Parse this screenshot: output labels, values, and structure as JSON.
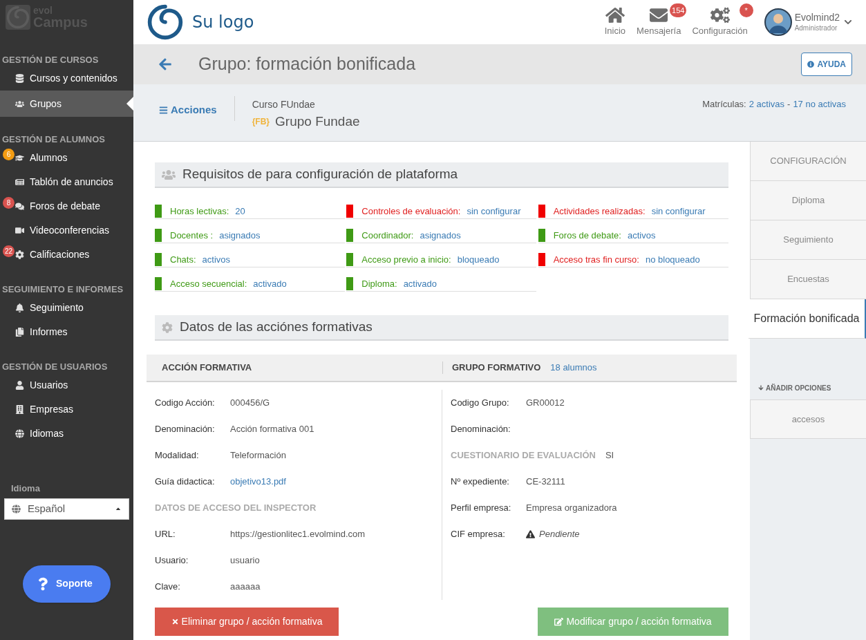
{
  "sidebar": {
    "brand": {
      "top": "evol",
      "bottom": "Campus"
    },
    "sections": [
      {
        "title": "GESTIÓN DE CURSOS",
        "items": [
          {
            "label": "Cursos y contenidos",
            "selected": false
          },
          {
            "label": "Grupos",
            "selected": true
          }
        ]
      },
      {
        "title": "GESTIÓN DE ALUMNOS",
        "items": [
          {
            "label": "Alumnos",
            "selected": false,
            "badge": "6",
            "color": "#f39c12"
          },
          {
            "label": "Tablón de anuncios",
            "selected": false
          },
          {
            "label": "Foros de debate",
            "selected": false,
            "badge": "8",
            "color": "#d9534f"
          },
          {
            "label": "Videoconferencias",
            "selected": false
          },
          {
            "label": "Calificaciones",
            "selected": false,
            "badge": "22",
            "color": "#d9534f"
          }
        ]
      },
      {
        "title": "SEGUIMIENTO E INFORMES",
        "items": [
          {
            "label": "Seguimiento",
            "selected": false
          },
          {
            "label": "Informes",
            "selected": false
          }
        ]
      },
      {
        "title": "GESTIÓN DE USUARIOS",
        "items": [
          {
            "label": "Usuarios",
            "selected": false
          },
          {
            "label": "Empresas",
            "selected": false
          },
          {
            "label": "Idiomas",
            "selected": false
          }
        ]
      }
    ],
    "language": {
      "label": "Idioma",
      "value": "Español"
    },
    "support": "Soporte"
  },
  "header": {
    "logo": "Su logo",
    "nav": [
      {
        "label": "Inicio"
      },
      {
        "label": "Mensajería",
        "badge": "154"
      },
      {
        "label": "Configuración",
        "badge": "*"
      }
    ],
    "user": {
      "name": "Evolmind2",
      "role": "Administrador"
    }
  },
  "title_bar": {
    "title": "Grupo: formación bonificada",
    "help": "AYUDA"
  },
  "sub_header": {
    "actions": "Acciones",
    "course": "Curso FUndae",
    "tag": "{FB}",
    "group": "Grupo Fundae",
    "enrollments_label": "Matrículas:",
    "active": "2 activas",
    "separator": "-",
    "inactive": "17 no activas"
  },
  "requirements": {
    "title": "Requisitos de para configuración de plataforma",
    "items": [
      {
        "label": "Horas lectivas:",
        "value": "20",
        "ok": true
      },
      {
        "label": "Controles de evaluación:",
        "value": "sin configurar",
        "ok": false
      },
      {
        "label": "Actividades realizadas:",
        "value": "sin configurar",
        "ok": false
      },
      {
        "label": "Docentes :",
        "value": "asignados",
        "ok": true
      },
      {
        "label": "Coordinador:",
        "value": "asignados",
        "ok": true
      },
      {
        "label": "Foros de debate:",
        "value": "activos",
        "ok": true
      },
      {
        "label": "Chats:",
        "value": "activos",
        "ok": true
      },
      {
        "label": "Acceso previo a inicio:",
        "value": "bloqueado",
        "ok": true
      },
      {
        "label": "Acceso tras fin curso:",
        "value": "no bloqueado",
        "ok": false
      },
      {
        "label": "Acceso secuencial:",
        "value": "activado",
        "ok": true
      },
      {
        "label": "Diploma:",
        "value": "activado",
        "ok": true
      }
    ]
  },
  "training": {
    "title": "Datos de las acciónes formativas",
    "left": {
      "heading": "ACCIÓN FORMATIVA",
      "rows": [
        {
          "kind": "field",
          "label": "Codigo Acción:",
          "value": "000456/G"
        },
        {
          "kind": "field",
          "label": "Denominación:",
          "value": "Acción formativa 001"
        },
        {
          "kind": "field",
          "label": "Modalidad:",
          "value": "Teleformación"
        },
        {
          "kind": "link",
          "label": "Guía didactica:",
          "value": "objetivo13.pdf"
        },
        {
          "kind": "heading",
          "label": "DATOS DE ACCESO DEL INSPECTOR"
        },
        {
          "kind": "field",
          "label": "URL:",
          "value": "https://gestionlitec1.evolmind.com"
        },
        {
          "kind": "field",
          "label": "Usuario:",
          "value": "usuario"
        },
        {
          "kind": "field",
          "label": "Clave:",
          "value": "aaaaaa"
        }
      ]
    },
    "right": {
      "heading": "GRUPO FORMATIVO",
      "count": "18 alumnos",
      "rows": [
        {
          "kind": "field",
          "label": "Codigo Grupo:",
          "value": "GR00012"
        },
        {
          "kind": "field",
          "label": "Denominación:"
        },
        {
          "kind": "heading",
          "label": "CUESTIONARIO DE EVALUACIÓN",
          "value": "SI"
        },
        {
          "kind": "field",
          "label": "Nº expediente:",
          "value": "CE-32111"
        },
        {
          "kind": "field",
          "label": "Perfil empresa:",
          "value": "Empresa organizadora"
        },
        {
          "kind": "warning",
          "label": "CIF empresa:",
          "value": "Pendiente"
        }
      ]
    }
  },
  "buttons": {
    "delete": "Eliminar grupo / acción formativa",
    "edit": "Modificar grupo / acción formativa"
  },
  "side_tabs": [
    {
      "label": "CONFIGURACIÓN",
      "selected": false
    },
    {
      "label": "Diploma",
      "selected": false
    },
    {
      "label": "Seguimiento",
      "selected": false
    },
    {
      "label": "Encuestas",
      "selected": false
    },
    {
      "label": "Formación bonificada",
      "selected": true
    }
  ],
  "options": {
    "heading": "AÑADIR OPCIONES",
    "items": [
      "accesos"
    ]
  }
}
